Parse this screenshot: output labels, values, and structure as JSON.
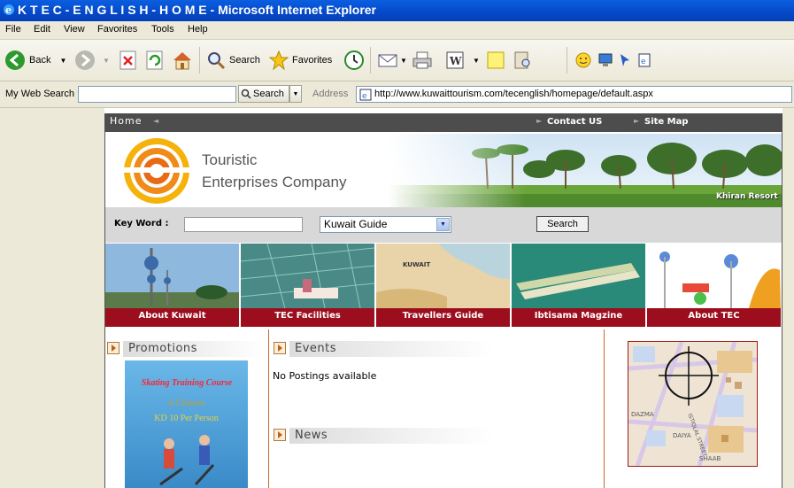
{
  "window": {
    "title": "K T E C - E N G L I S H - H O M E - Microsoft Internet Explorer"
  },
  "menu": [
    "File",
    "Edit",
    "View",
    "Favorites",
    "Tools",
    "Help"
  ],
  "toolbar": {
    "back": "Back",
    "search": "Search",
    "favorites": "Favorites"
  },
  "websearch": {
    "label": "My Web Search",
    "value": "",
    "button": "Search"
  },
  "address": {
    "label": "Address",
    "url": "http://www.kuwaittourism.com/tecenglish/homepage/default.aspx"
  },
  "site": {
    "nav": {
      "home": "Home",
      "contact": "Contact US",
      "sitemap": "Site Map"
    },
    "brand": {
      "line1": "Touristic",
      "line2": "Enterprises Company"
    },
    "banner_caption": "Khiran Resort",
    "keyword": {
      "label": "Key Word :",
      "value": "",
      "select": "Kuwait Guide",
      "button": "Search"
    },
    "tiles": [
      {
        "label": "About Kuwait"
      },
      {
        "label": "TEC Facilities"
      },
      {
        "label": "Travellers Guide"
      },
      {
        "label": "Ibtisama Magzine"
      },
      {
        "label": "About TEC"
      }
    ],
    "sections": {
      "promotions": "Promotions",
      "events": "Events",
      "news": "News"
    },
    "events_text": "No Postings available",
    "promo": {
      "title": "Skating Training Course",
      "classes": "4 Classes",
      "price": "KD 10 Per Person"
    },
    "map_labels": {
      "kuwait": "KUWAIT",
      "dazma": "DAZMA",
      "daiya": "DAIYA",
      "shaab": "SHAAB",
      "street": "ISTIQLAL STREET"
    }
  },
  "colors": {
    "accent_red": "#9c0e1d",
    "nav_gray": "#4d4d4d",
    "xp_blue": "#0548c8"
  }
}
